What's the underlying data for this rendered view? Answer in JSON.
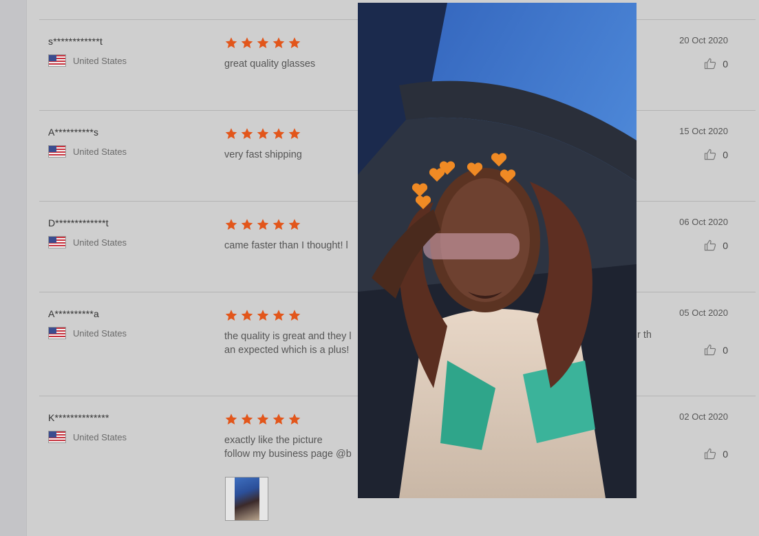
{
  "reviews": [
    {
      "user": "s************t",
      "country": "United States",
      "rating": 5,
      "text": [
        "great quality glasses"
      ],
      "date": "20 Oct 2020",
      "likes": "0"
    },
    {
      "user": "A**********s",
      "country": "United States",
      "rating": 5,
      "text": [
        "very fast shipping"
      ],
      "date": "15 Oct 2020",
      "likes": "0"
    },
    {
      "user": "D*************t",
      "country": "United States",
      "rating": 5,
      "text": [
        "came faster than I thought! l"
      ],
      "date": "06 Oct 2020",
      "likes": "0"
    },
    {
      "user": "A**********a",
      "country": "United States",
      "rating": 5,
      "text": [
        "the quality is great and they l",
        "an expected which is a plus!"
      ],
      "text_overflow": "r th",
      "date": "05 Oct 2020",
      "likes": "0"
    },
    {
      "user": "K**************",
      "country": "United States",
      "rating": 5,
      "text": [
        "exactly like the picture",
        "follow my business page @b"
      ],
      "date": "02 Oct 2020",
      "likes": "0",
      "has_photo": true
    }
  ],
  "colors": {
    "star": "#e2561b",
    "background": "#cfcfcf",
    "separator": "#b3b3b3"
  },
  "icons": {
    "rating": "star-icon",
    "like": "thumbs-up-icon",
    "country": "us-flag-icon"
  }
}
